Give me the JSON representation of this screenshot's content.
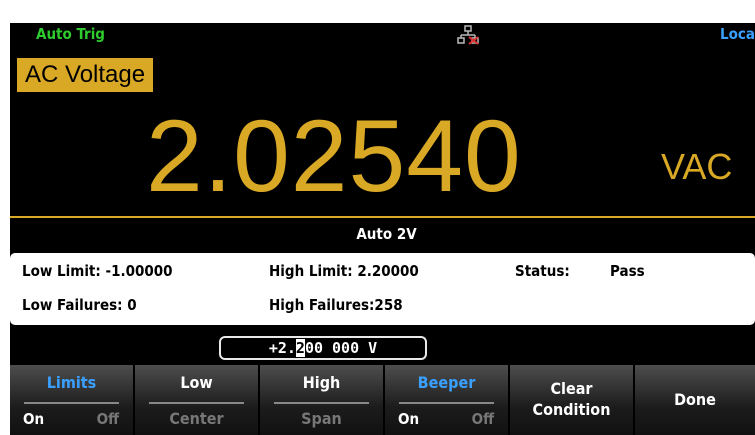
{
  "status_bar": {
    "trigger": "Auto Trig",
    "remote": "Loca",
    "network_icon": "network-disconnected-icon"
  },
  "function_label": "AC Voltage",
  "reading": {
    "value": "2.02540",
    "unit": "VAC"
  },
  "range_label": "Auto 2V",
  "limits_panel": {
    "low_limit_label": "Low Limit: -1.00000",
    "high_limit_label": "High Limit: 2.20000",
    "status_label": "Status:",
    "status_value": "Pass",
    "low_failures_label": "Low Failures: 0",
    "high_failures_label": "High Failures:258"
  },
  "input": {
    "before_cursor": "+2.",
    "cursor_char": "2",
    "after_cursor": "00 000 V"
  },
  "softkeys": {
    "limits": {
      "label": "Limits",
      "on": "On",
      "off": "Off"
    },
    "low": {
      "label": "Low",
      "sub": "Center"
    },
    "high": {
      "label": "High",
      "sub": "Span"
    },
    "beeper": {
      "label": "Beeper",
      "on": "On",
      "off": "Off"
    },
    "clear": {
      "line1": "Clear",
      "line2": "Condition"
    },
    "done": {
      "label": "Done"
    }
  },
  "colors": {
    "accent": "#d9a824",
    "trigger": "#2ecc2e",
    "remote": "#3aa0ff",
    "background": "#000000"
  }
}
